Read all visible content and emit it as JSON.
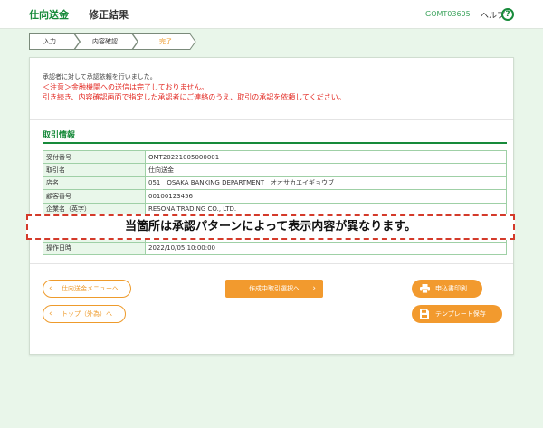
{
  "header": {
    "title": "仕向送金",
    "subtitle": "修正結果",
    "screen_code": "GOMT03605",
    "help_label": "ヘルプ",
    "help_icon": "?"
  },
  "steps": [
    {
      "label": "入力",
      "state": "done"
    },
    {
      "label": "内容確認",
      "state": "done"
    },
    {
      "label": "完了",
      "state": "current"
    }
  ],
  "message": {
    "line1": "承認者に対して承認依頼を行いました。",
    "line2": "＜注意＞金融機関への送信は完了しておりません。",
    "line3": "引き続き、内容確認画面で指定した承認者にご連絡のうえ、取引の承認を依頼してください。"
  },
  "section": {
    "title": "取引情報"
  },
  "table": {
    "rows": [
      {
        "label": "受付番号",
        "value": "OMT20221005000001"
      },
      {
        "label": "取引名",
        "value": "仕向送金"
      },
      {
        "label": "店名",
        "value": "051　OSAKA BANKING DEPARTMENT　オオサカエイギョウブ"
      },
      {
        "label": "顧客番号",
        "value": "00100123456"
      },
      {
        "label": "企業名（英字）",
        "value": "RESONA TRADING CO., LTD."
      },
      {
        "label": "",
        "value": ""
      },
      {
        "label": "",
        "value": ""
      },
      {
        "label": "操作日時",
        "value": "2022/10/05 10:00:00"
      }
    ]
  },
  "notice": "当箇所は承認パターンによって表示内容が異なります。",
  "buttons": {
    "menu": "仕向送金メニューへ",
    "top": "トップ（外為）へ",
    "select_in_progress": "作成中取引選択へ",
    "print": "申込書印刷",
    "save_template": "テンプレート保存"
  },
  "colors": {
    "brand_green": "#178a3a",
    "accent_orange": "#f29a2e",
    "warning_red": "#e32b24",
    "background": "#e9f6ea"
  }
}
